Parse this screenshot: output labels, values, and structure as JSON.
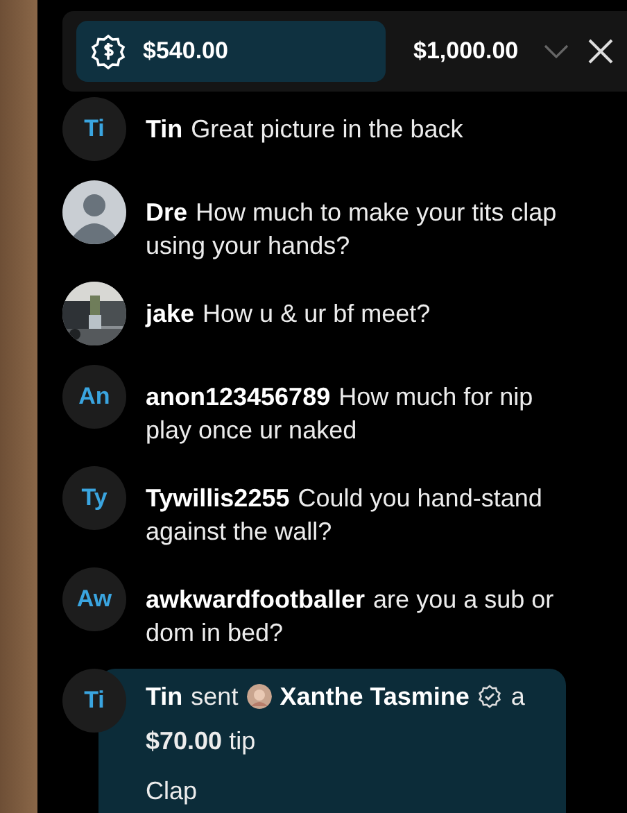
{
  "tip_goal": {
    "current": "$540.00",
    "goal": "$1,000.00"
  },
  "messages": [
    {
      "kind": "text",
      "avatar": {
        "kind": "initials",
        "initials": "Ti"
      },
      "user": "Tin",
      "text": "Great picture in the back"
    },
    {
      "kind": "text",
      "avatar": {
        "kind": "default"
      },
      "user": "Dre",
      "text": "How much to make your tits clap using your hands?"
    },
    {
      "kind": "text",
      "user": "jake",
      "text": "How u & ur bf meet?"
    },
    {
      "kind": "text",
      "avatar": {
        "kind": "initials",
        "initials": "An"
      },
      "user": "anon123456789",
      "text": "How much for nip play once ur naked"
    },
    {
      "kind": "text",
      "avatar": {
        "kind": "initials",
        "initials": "Ty"
      },
      "user": "Tywillis2255",
      "text": "Could you hand-stand against the wall?"
    },
    {
      "kind": "text",
      "avatar": {
        "kind": "initials",
        "initials": "Aw"
      },
      "user": "awkwardfootballer",
      "text": "are you a sub or dom in bed?"
    },
    {
      "kind": "tip",
      "avatar": {
        "kind": "initials",
        "initials": "Ti"
      },
      "user": "Tin",
      "verb": "sent",
      "recipient": "Xanthe Tasmine",
      "after": "a",
      "amount": "**$70.00** tip",
      "note": "Clap"
    }
  ]
}
